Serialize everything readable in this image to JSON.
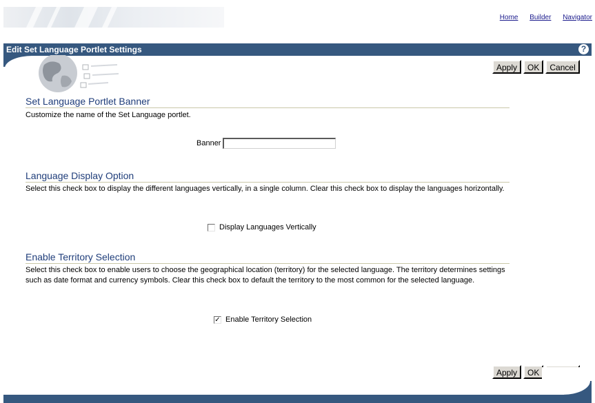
{
  "nav": {
    "links": [
      "Home",
      "Builder",
      "Navigator"
    ]
  },
  "header": {
    "title": "Edit Set Language Portlet Settings",
    "help_icon": "?"
  },
  "buttons": {
    "apply": "Apply",
    "ok": "OK",
    "cancel": "Cancel"
  },
  "sections": {
    "banner": {
      "title": "Set Language Portlet Banner",
      "description": "Customize the name of the Set Language portlet.",
      "field_label": "Banner",
      "field_value": ""
    },
    "display": {
      "title": "Language Display Option",
      "description": "Select this check box to display the different languages vertically, in a single column. Clear this check box to display the languages horizontally.",
      "checkbox_label": "Display Languages Vertically",
      "checked": false
    },
    "territory": {
      "title": "Enable Territory Selection",
      "description": "Select this check box to enable users to choose the geographical location (territory) for the selected language. The territory determines settings such as date format and currency symbols. Clear this check box to default the territory to the most common for the selected language.",
      "checkbox_label": "Enable Territory Selection",
      "checked": true
    }
  },
  "colors": {
    "header_bg": "#36587f",
    "section_title": "#1f3d7a",
    "link": "#1a1a8c"
  }
}
